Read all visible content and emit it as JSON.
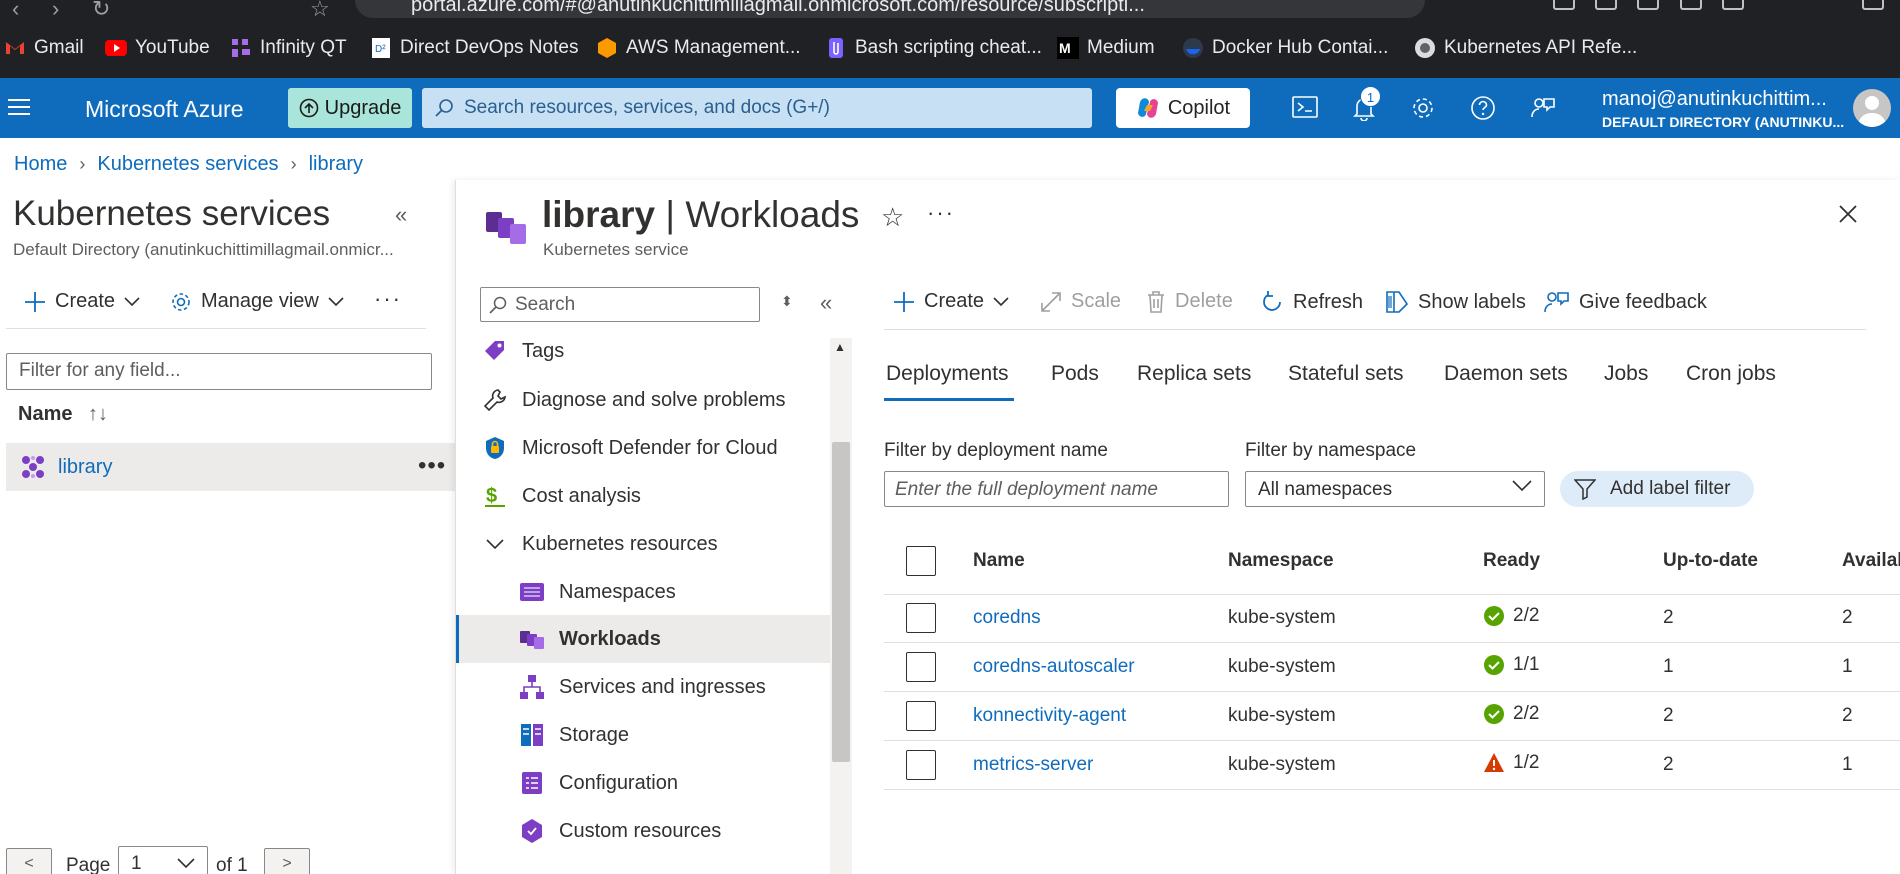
{
  "browser": {
    "url": "portal.azure.com/#@anutinkuchittimillagmail.onmicrosoft.com/resource/subscripti...",
    "bookmarks": [
      {
        "label": "Gmail",
        "icon": "gmail-icon"
      },
      {
        "label": "YouTube",
        "icon": "youtube-icon"
      },
      {
        "label": "Infinity QT",
        "icon": "infinity-qt-icon"
      },
      {
        "label": "Direct DevOps Notes",
        "icon": "doc-icon"
      },
      {
        "label": "AWS Management...",
        "icon": "aws-icon"
      },
      {
        "label": "Bash scripting cheat...",
        "icon": "clip-icon"
      },
      {
        "label": "Medium",
        "icon": "medium-icon"
      },
      {
        "label": "Docker Hub Contai...",
        "icon": "docker-icon"
      },
      {
        "label": "Kubernetes API Refe...",
        "icon": "kubernetes-icon"
      }
    ]
  },
  "topbar": {
    "brand": "Microsoft Azure",
    "upgrade": "Upgrade",
    "search_placeholder": "Search resources, services, and docs (G+/)",
    "copilot": "Copilot",
    "notification_count": "1",
    "user_name": "manoj@anutinkuchittim...",
    "user_directory": "DEFAULT DIRECTORY (ANUTINKU...",
    "colors": {
      "bar": "#0f6cbd",
      "upgrade": "#a9e5da",
      "search": "#c7e0f4"
    }
  },
  "breadcrumb": [
    "Home",
    "Kubernetes services",
    "library"
  ],
  "left_panel": {
    "title": "Kubernetes services",
    "subtitle": "Default Directory (anutinkuchittimillagmail.onmicr...",
    "create": "Create",
    "manage_view": "Manage view",
    "filter_placeholder": "Filter for any field...",
    "name_header": "Name",
    "sort_icon": "↑↓",
    "rows": [
      {
        "name": "library"
      }
    ],
    "pagination": {
      "prev": "<",
      "label": "Page",
      "page": "1",
      "of": "of 1",
      "next": ">"
    }
  },
  "blade": {
    "resource": "library",
    "section": "Workloads",
    "title_sep": "|",
    "subtitle": "Kubernetes service",
    "nav_search_placeholder": "Search",
    "nav": [
      {
        "label": "Tags",
        "icon": "tag-icon",
        "indent": false
      },
      {
        "label": "Diagnose and solve problems",
        "icon": "wrench-icon",
        "indent": false
      },
      {
        "label": "Microsoft Defender for Cloud",
        "icon": "shield-icon",
        "indent": false
      },
      {
        "label": "Cost analysis",
        "icon": "cost-icon",
        "indent": false
      },
      {
        "label": "Kubernetes resources",
        "icon": "chevron-down-icon",
        "indent": false
      },
      {
        "label": "Namespaces",
        "icon": "namespaces-icon",
        "indent": true
      },
      {
        "label": "Workloads",
        "icon": "workloads-icon",
        "indent": true,
        "selected": true
      },
      {
        "label": "Services and ingresses",
        "icon": "services-icon",
        "indent": true
      },
      {
        "label": "Storage",
        "icon": "storage-icon",
        "indent": true
      },
      {
        "label": "Configuration",
        "icon": "configuration-icon",
        "indent": true
      },
      {
        "label": "Custom resources",
        "icon": "custom-resources-icon",
        "indent": true
      }
    ],
    "commands": {
      "create": "Create",
      "scale": "Scale",
      "delete": "Delete",
      "refresh": "Refresh",
      "show_labels": "Show labels",
      "feedback": "Give feedback"
    },
    "tabs": [
      "Deployments",
      "Pods",
      "Replica sets",
      "Stateful sets",
      "Daemon sets",
      "Jobs",
      "Cron jobs"
    ],
    "active_tab": "Deployments",
    "filters": {
      "deployment_label": "Filter by deployment name",
      "deployment_placeholder": "Enter the full deployment name",
      "namespace_label": "Filter by namespace",
      "namespace_value": "All namespaces",
      "add_label": "Add label filter"
    },
    "table": {
      "columns": [
        "Name",
        "Namespace",
        "Ready",
        "Up-to-date",
        "Availab"
      ],
      "rows": [
        {
          "name": "coredns",
          "namespace": "kube-system",
          "ready": "2/2",
          "status": "ok",
          "up_to_date": "2",
          "available": "2"
        },
        {
          "name": "coredns-autoscaler",
          "namespace": "kube-system",
          "ready": "1/1",
          "status": "ok",
          "up_to_date": "1",
          "available": "1"
        },
        {
          "name": "konnectivity-agent",
          "namespace": "kube-system",
          "ready": "2/2",
          "status": "ok",
          "up_to_date": "2",
          "available": "2"
        },
        {
          "name": "metrics-server",
          "namespace": "kube-system",
          "ready": "1/2",
          "status": "warning",
          "up_to_date": "2",
          "available": "1"
        }
      ]
    }
  }
}
